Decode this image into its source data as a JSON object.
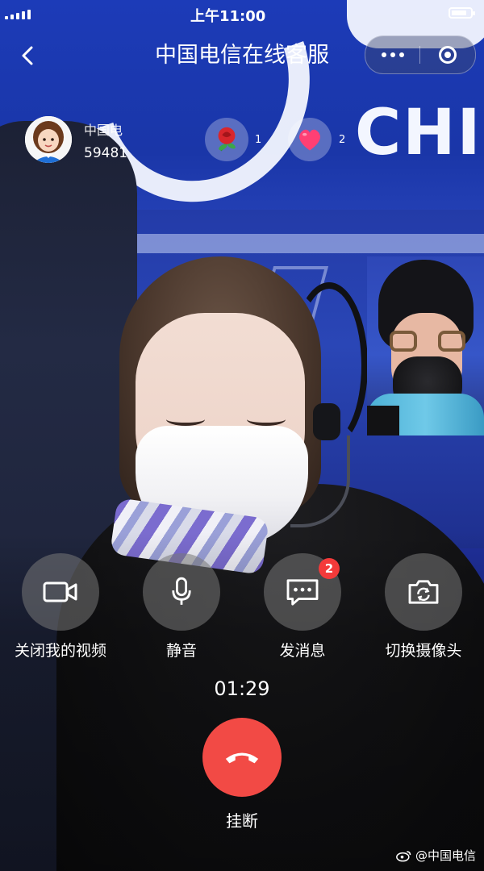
{
  "status_bar": {
    "time": "上午11:00"
  },
  "header": {
    "title": "中国电信在线客服"
  },
  "agent": {
    "name": "中国电",
    "id": "59481"
  },
  "reactions": [
    {
      "icon": "rose-icon",
      "count": "1"
    },
    {
      "icon": "heart-icon",
      "count": "2"
    }
  ],
  "banner": {
    "text": "CHI"
  },
  "controls": [
    {
      "label": "关闭我的视频",
      "icon": "video-camera-icon"
    },
    {
      "label": "静音",
      "icon": "microphone-icon"
    },
    {
      "label": "发消息",
      "icon": "message-icon",
      "badge": "2"
    },
    {
      "label": "切换摄像头",
      "icon": "switch-camera-icon"
    }
  ],
  "call": {
    "duration": "01:29",
    "hangup_label": "挂断"
  },
  "watermark": {
    "text": "@中国电信"
  },
  "colors": {
    "hangup": "#f24a45",
    "badge": "#f43a3a",
    "background": "#1f2f9a"
  }
}
